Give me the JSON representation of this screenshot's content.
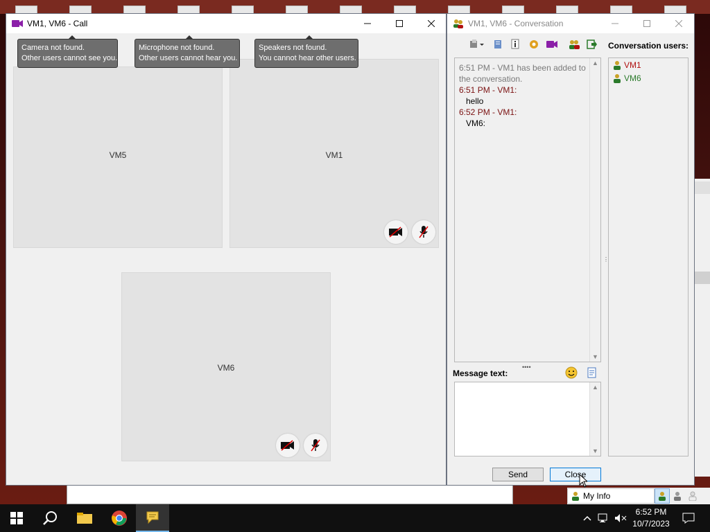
{
  "call_window": {
    "title": "VM1, VM6 - Call",
    "tooltips": [
      {
        "line1": "Camera not found.",
        "line2": "Other users cannot see you."
      },
      {
        "line1": "Microphone not found.",
        "line2": "Other users cannot hear you."
      },
      {
        "line1": "Speakers not found.",
        "line2": "You cannot hear other users."
      }
    ],
    "tiles": [
      {
        "label": "VM5"
      },
      {
        "label": "VM1"
      },
      {
        "label": "VM6"
      }
    ]
  },
  "conversation_window": {
    "title": "VM1, VM6 - Conversation",
    "users_label": "Conversation users:",
    "users": [
      "VM1",
      "VM6"
    ],
    "messages": {
      "system": "6:51 PM - VM1 has been added to the conversation.",
      "m1_head": "6:51 PM - VM1:",
      "m1_body": "hello",
      "m2_head": "6:52 PM - VM1:",
      "m2_body": "VM6:"
    },
    "message_label": "Message text:",
    "send_label": "Send",
    "close_label": "Close"
  },
  "status": {
    "myinfo": "My Info"
  },
  "taskbar": {
    "time": "6:52 PM",
    "date": "10/7/2023"
  },
  "colors": {
    "user_online": "#2a7a2a",
    "user_self": "#b01010",
    "message_head": "#7a1010"
  }
}
